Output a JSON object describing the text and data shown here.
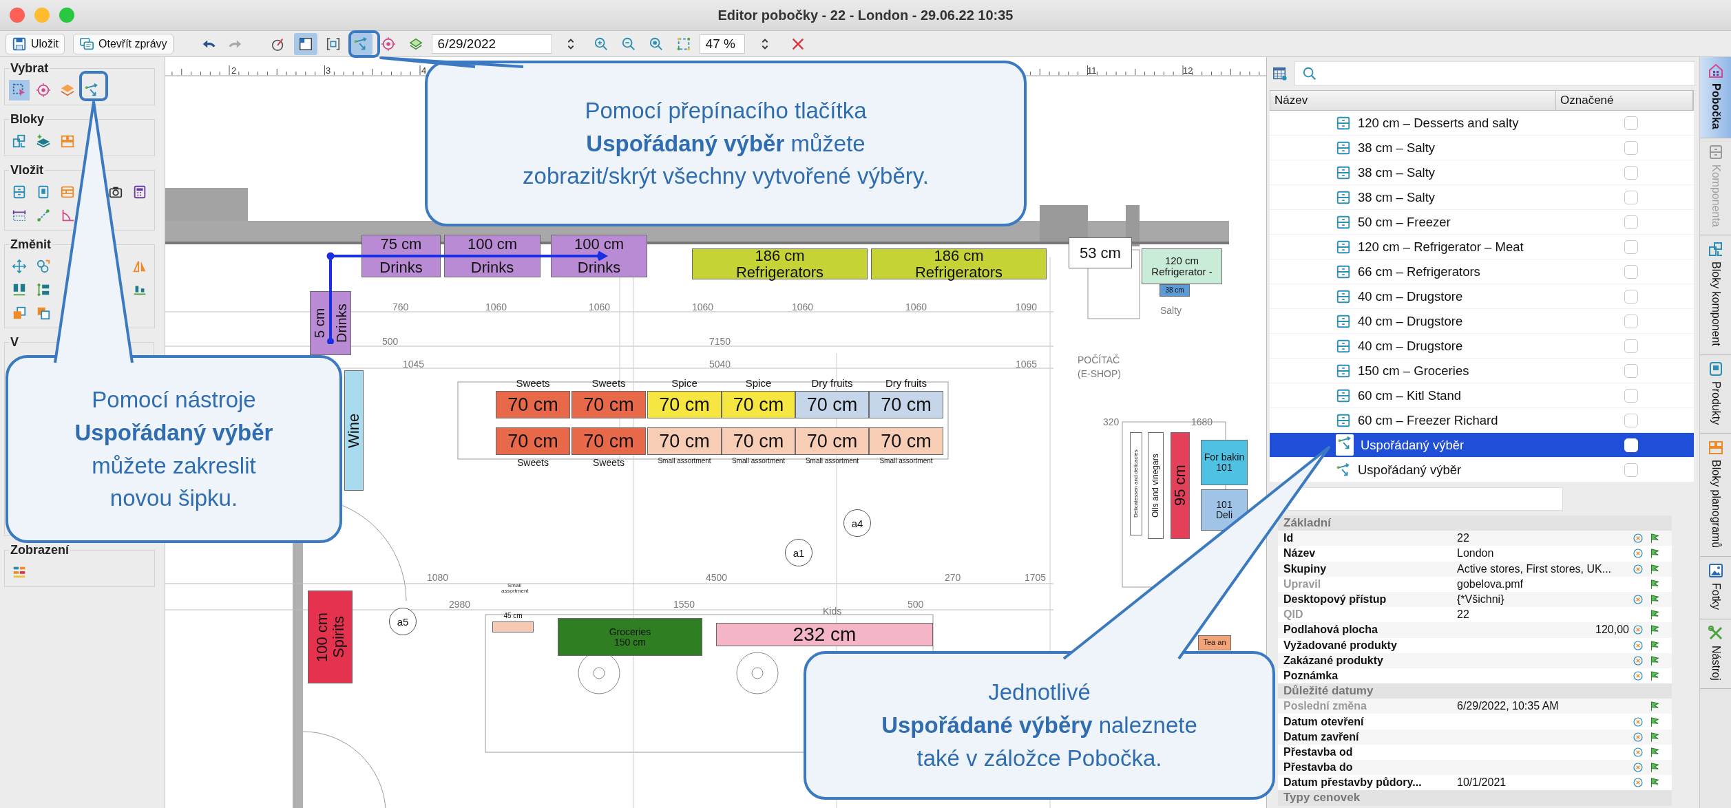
{
  "window": {
    "title": "Editor pobočky - 22 - London - 29.06.22 10:35"
  },
  "toolbar": {
    "buttons": [
      {
        "kind": "save",
        "label": "Uložit"
      },
      {
        "kind": "messages",
        "label": "Otevřít zprávy"
      }
    ],
    "history": [
      {
        "kind": "undo",
        "disabled": false
      },
      {
        "kind": "redo",
        "disabled": true
      }
    ],
    "tools": [
      {
        "kind": "measure",
        "selected": false
      },
      {
        "kind": "frame",
        "selected": true
      },
      {
        "kind": "group",
        "selected": false
      },
      {
        "kind": "arranged",
        "selected": true
      },
      {
        "kind": "target",
        "selected": false
      },
      {
        "kind": "layers",
        "selected": false
      }
    ],
    "date": {
      "value": "6/29/2022"
    },
    "zoom_tools": [
      {
        "kind": "zoom-in"
      },
      {
        "kind": "zoom-out"
      },
      {
        "kind": "zoom-reset"
      },
      {
        "kind": "fit"
      }
    ],
    "zoom": {
      "value": "47 %"
    }
  },
  "palette": [
    {
      "title": "Vybrat",
      "rows": [
        {
          "left": [
            {
              "kind": "select-rect",
              "selected": true
            },
            {
              "kind": "target",
              "selected": false
            },
            {
              "kind": "stack",
              "selected": false
            },
            {
              "kind": "arranged",
              "selected": false
            }
          ]
        }
      ]
    },
    {
      "title": "Bloky",
      "rows": [
        {
          "left": [
            {
              "kind": "block"
            },
            {
              "kind": "block-add"
            },
            {
              "kind": "shelf-blocks"
            }
          ]
        }
      ]
    },
    {
      "title": "Vložit",
      "rows": [
        {
          "left": [
            {
              "kind": "cabinet"
            },
            {
              "kind": "fridge"
            },
            {
              "kind": "shelving"
            }
          ],
          "right": [
            {
              "kind": "camera"
            },
            {
              "kind": "calculator"
            }
          ]
        },
        {
          "left": [
            {
              "kind": "dimension"
            },
            {
              "kind": "line"
            },
            {
              "kind": "angle"
            }
          ]
        }
      ]
    },
    {
      "title": "Změnit",
      "rows": [
        {
          "left": [
            {
              "kind": "move"
            },
            {
              "kind": "swap"
            }
          ],
          "right": [
            {
              "kind": "mirror"
            }
          ]
        },
        {
          "left": [
            {
              "kind": "align"
            },
            {
              "kind": "spacing"
            }
          ],
          "right": [
            {
              "kind": "distribute"
            }
          ]
        },
        {
          "left": [
            {
              "kind": "front"
            },
            {
              "kind": "back"
            }
          ]
        }
      ]
    },
    {
      "title": "V"
    },
    {
      "title": "Zobrazení",
      "rows": [
        {
          "left": [
            {
              "kind": "display"
            }
          ]
        }
      ]
    }
  ],
  "canvas": {
    "ruler": [
      "2",
      "3",
      "4",
      "11",
      "12"
    ],
    "fixtures": [
      {
        "kind": "horizontal",
        "color": "#b98bd4",
        "lines": [
          "75 cm",
          "Drinks"
        ]
      },
      {
        "kind": "horizontal",
        "color": "#b98bd4",
        "lines": [
          "100 cm",
          "Drinks"
        ]
      },
      {
        "kind": "horizontal",
        "color": "#b98bd4",
        "lines": [
          "100 cm",
          "Drinks"
        ]
      },
      {
        "kind": "vertical",
        "color": "#b98bd4",
        "lines": [
          "5 cm",
          "Drinks"
        ]
      },
      {
        "kind": "vertical",
        "color": "#a8dbee",
        "lines": [
          "Wine"
        ]
      },
      {
        "kind": "horizontal",
        "color": "#c6d334",
        "lines": [
          "186 cm",
          "Refrigerators"
        ]
      },
      {
        "kind": "horizontal",
        "color": "#c6d334",
        "lines": [
          "186 cm",
          "Refrigerators"
        ]
      },
      {
        "kind": "horizontal",
        "color": "#ffffff",
        "lines": [
          "53 cm"
        ]
      },
      {
        "kind": "horizontal",
        "color": "#c8ecd8",
        "lines": [
          "120 cm",
          "Refrigerator -"
        ]
      },
      {
        "kind": "horizontal",
        "color": "#5b9bd5",
        "lines": [
          "38 cm"
        ]
      },
      {
        "kind": "horizontal",
        "color": "#e8694a",
        "lines": [
          "70 cm"
        ],
        "above": "Sweets"
      },
      {
        "kind": "horizontal",
        "color": "#e8694a",
        "lines": [
          "70 cm"
        ],
        "above": "Sweets"
      },
      {
        "kind": "horizontal",
        "color": "#f5e642",
        "lines": [
          "70 cm"
        ],
        "above": "Spice"
      },
      {
        "kind": "horizontal",
        "color": "#f5e642",
        "lines": [
          "70 cm"
        ],
        "above": "Spice"
      },
      {
        "kind": "horizontal",
        "color": "#c5d5ea",
        "lines": [
          "70 cm"
        ],
        "above": "Dry fruits"
      },
      {
        "kind": "horizontal",
        "color": "#c5d5ea",
        "lines": [
          "70 cm"
        ],
        "above": "Dry fruits"
      },
      {
        "kind": "horizontal",
        "color": "#e8694a",
        "lines": [
          "70 cm"
        ],
        "below": "Sweets"
      },
      {
        "kind": "horizontal",
        "color": "#e8694a",
        "lines": [
          "70 cm"
        ],
        "below": "Sweets"
      },
      {
        "kind": "horizontal",
        "color": "#f7cdb5",
        "lines": [
          "70 cm"
        ],
        "below": "Small assortment"
      },
      {
        "kind": "horizontal",
        "color": "#f7cdb5",
        "lines": [
          "70 cm"
        ],
        "below": "Small assortment"
      },
      {
        "kind": "horizontal",
        "color": "#f7cdb5",
        "lines": [
          "70 cm"
        ],
        "below": "Small assortment"
      },
      {
        "kind": "horizontal",
        "color": "#f7cdb5",
        "lines": [
          "70 cm"
        ],
        "below": "Small assortment"
      },
      {
        "kind": "vertical",
        "color": "#ffffff",
        "lines": [
          "Oils and vinegars"
        ]
      },
      {
        "kind": "vertical",
        "color": "#ffffff",
        "lines": [
          "Delicatessen and delicacies"
        ]
      },
      {
        "kind": "vertical",
        "color": "#e5405a",
        "lines": [
          "95 cm"
        ]
      },
      {
        "kind": "horizontal",
        "color": "#4fc1e3",
        "lines": [
          "For bakin",
          "101"
        ]
      },
      {
        "kind": "horizontal",
        "color": "#a0c4e8",
        "lines": [
          "101",
          "Deli"
        ]
      },
      {
        "kind": "vertical",
        "color": "#e5334f",
        "lines": [
          "100 cm",
          "Spirits"
        ]
      },
      {
        "kind": "horizontal",
        "color": "#f5c9b3",
        "above": "45 cm"
      },
      {
        "kind": "horizontal",
        "color": "#2f7e22",
        "lines": [
          "Groceries",
          "150 cm"
        ]
      },
      {
        "kind": "horizontal",
        "color": "#f4b6c6",
        "lines": [
          "232 cm"
        ]
      },
      {
        "kind": "horizontal",
        "color": "#f2a478",
        "lines": [
          "Tea an"
        ]
      }
    ],
    "labels": [
      "760",
      "1060",
      "1060",
      "1060",
      "1060",
      "1060",
      "1090",
      "500",
      "7150",
      "1045",
      "5040",
      "1065",
      "POČÍTAČ",
      "(E-SHOP)",
      "320",
      "1680",
      "1080",
      "4500",
      "270",
      "1705",
      "2980",
      "1550",
      "500",
      "Small assortment",
      "Kids",
      "Salty"
    ],
    "markers": [
      "a4",
      "a1",
      "a5"
    ]
  },
  "tree": {
    "columns": [
      "Název",
      "Označené"
    ],
    "items": [
      {
        "kind": "shelf",
        "name": "120 cm – Desserts and salty",
        "checked": false,
        "selected": false
      },
      {
        "kind": "shelf",
        "name": "38 cm – Salty",
        "checked": false,
        "selected": false
      },
      {
        "kind": "shelf",
        "name": "38 cm – Salty",
        "checked": false,
        "selected": false
      },
      {
        "kind": "shelf",
        "name": "38 cm – Salty",
        "checked": false,
        "selected": false
      },
      {
        "kind": "shelf",
        "name": "50 cm – Freezer",
        "checked": false,
        "selected": false
      },
      {
        "kind": "shelf",
        "name": "120 cm – Refrigerator – Meat",
        "checked": false,
        "selected": false
      },
      {
        "kind": "shelf",
        "name": "66 cm – Refrigerators",
        "checked": false,
        "selected": false
      },
      {
        "kind": "shelf",
        "name": "40 cm – Drugstore",
        "checked": false,
        "selected": false
      },
      {
        "kind": "shelf",
        "name": "40 cm – Drugstore",
        "checked": false,
        "selected": false
      },
      {
        "kind": "shelf",
        "name": "40 cm – Drugstore",
        "checked": false,
        "selected": false
      },
      {
        "kind": "shelf",
        "name": "150 cm – Groceries",
        "checked": false,
        "selected": false
      },
      {
        "kind": "shelf",
        "name": "60 cm – Kitl Stand",
        "checked": false,
        "selected": false
      },
      {
        "kind": "shelf",
        "name": "60 cm – Freezer Richard",
        "checked": false,
        "selected": false
      },
      {
        "kind": "arranged",
        "name": "Uspořádaný výběr",
        "checked": false,
        "selected": true
      },
      {
        "kind": "arranged",
        "name": "Uspořádaný výběr",
        "checked": false,
        "selected": false
      }
    ]
  },
  "properties": {
    "sections": [
      {
        "title": "Základní",
        "rows": [
          {
            "label": "Id",
            "value": "22",
            "kind": "text",
            "disabled": false
          },
          {
            "label": "Název",
            "value": "London",
            "kind": "text",
            "disabled": false
          },
          {
            "label": "Skupiny",
            "value": "Active stores, First stores, UK...",
            "kind": "text",
            "disabled": false
          },
          {
            "label": "Upravil",
            "value": "gobelova.pmf",
            "kind": "text",
            "disabled": true
          },
          {
            "label": "Desktopový přístup",
            "value": "{*Všichni}",
            "kind": "text",
            "disabled": false
          },
          {
            "label": "QID",
            "value": "22",
            "kind": "text",
            "disabled": true
          },
          {
            "label": "Podlahová plocha",
            "value": "120,00",
            "kind": "number",
            "disabled": false
          },
          {
            "label": "Vyžadované produkty",
            "disabled": false
          },
          {
            "label": "Zakázané produkty",
            "disabled": false
          },
          {
            "label": "Poznámka",
            "disabled": false
          }
        ]
      },
      {
        "title": "Důležité datumy",
        "rows": [
          {
            "label": "Poslední změna",
            "value": "6/29/2022, 10:35 AM",
            "kind": "text",
            "disabled": true
          },
          {
            "label": "Datum otevření",
            "disabled": false
          },
          {
            "label": "Datum zavření",
            "disabled": false
          },
          {
            "label": "Přestavba od",
            "disabled": false
          },
          {
            "label": "Přestavba do",
            "disabled": false
          },
          {
            "label": "Datum přestavby půdory...",
            "value": "10/1/2021",
            "kind": "text",
            "disabled": false
          }
        ]
      },
      {
        "title": "Typy cenovek"
      }
    ]
  },
  "side_tabs": [
    {
      "kind": "branch",
      "label": "Pobočka",
      "selected": true,
      "disabled": false
    },
    {
      "kind": "component",
      "label": "Komponenta",
      "selected": false,
      "disabled": true
    },
    {
      "kind": "component-blocks",
      "label": "Bloky komponent",
      "selected": false,
      "disabled": false
    },
    {
      "kind": "products",
      "label": "Produkty",
      "selected": false,
      "disabled": false
    },
    {
      "kind": "planograms",
      "label": "Bloky planogramů",
      "selected": false,
      "disabled": false
    },
    {
      "kind": "photos",
      "label": "Fotky",
      "selected": false,
      "disabled": false
    },
    {
      "kind": "tools",
      "label": "Nástroj",
      "selected": false,
      "disabled": false
    }
  ],
  "callouts": [
    {
      "text": "Pomocí přepínacího tlačítka\n**Uspořádaný výběr** můžete\nzobrazit/skrýt všechny vytvořené výběry."
    },
    {
      "text": "Pomocí nástroje\n**Uspořádaný výběr**\nmůžete zakreslit\nnovou šipku."
    },
    {
      "text": "Jednotlivé\n**Uspořádané výběry** naleznete\ntaké v záložce Pobočka."
    }
  ]
}
